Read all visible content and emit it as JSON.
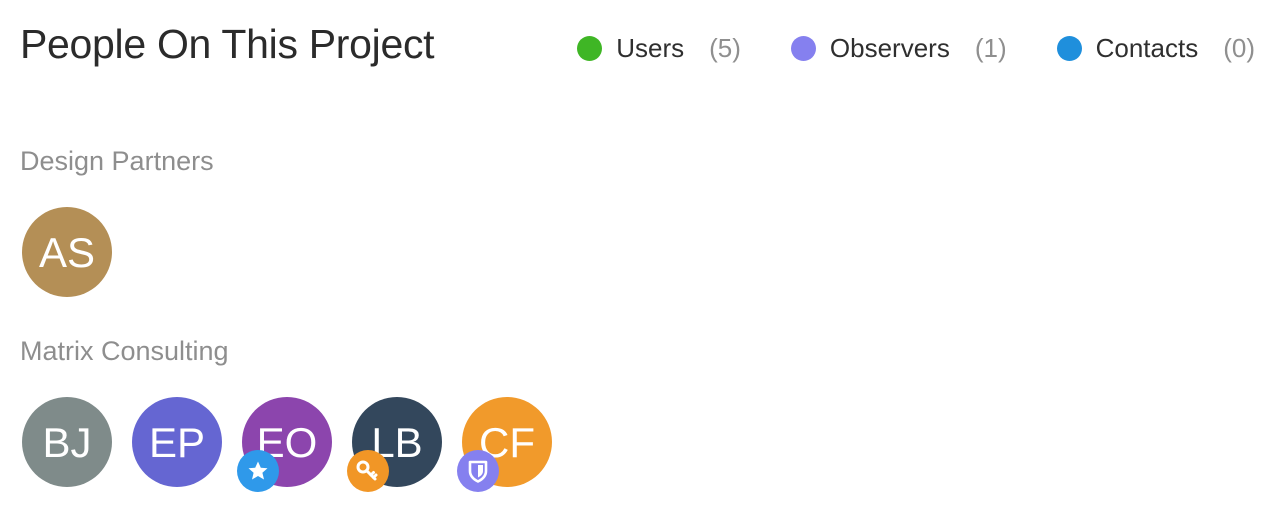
{
  "title": "People On This Project",
  "legend": [
    {
      "label": "Users",
      "count": "(5)",
      "color": "#3fb625"
    },
    {
      "label": "Observers",
      "count": "(1)",
      "color": "#8580ef"
    },
    {
      "label": "Contacts",
      "count": "(0)",
      "color": "#1f8fdc"
    }
  ],
  "groups": [
    {
      "name": "Design Partners",
      "members": [
        {
          "initials": "AS",
          "color": "#b48f56",
          "badge": null
        }
      ]
    },
    {
      "name": "Matrix Consulting",
      "members": [
        {
          "initials": "BJ",
          "color": "#7f8b8a",
          "badge": null
        },
        {
          "initials": "EP",
          "color": "#6566d2",
          "badge": null
        },
        {
          "initials": "EO",
          "color": "#8c45ad",
          "badge": {
            "icon": "star-icon",
            "color": "#2f99ea"
          }
        },
        {
          "initials": "LB",
          "color": "#33475c",
          "badge": {
            "icon": "key-icon",
            "color": "#f19626"
          }
        },
        {
          "initials": "CF",
          "color": "#f19a2b",
          "badge": {
            "icon": "shield-icon",
            "color": "#8580ef"
          }
        }
      ]
    }
  ]
}
